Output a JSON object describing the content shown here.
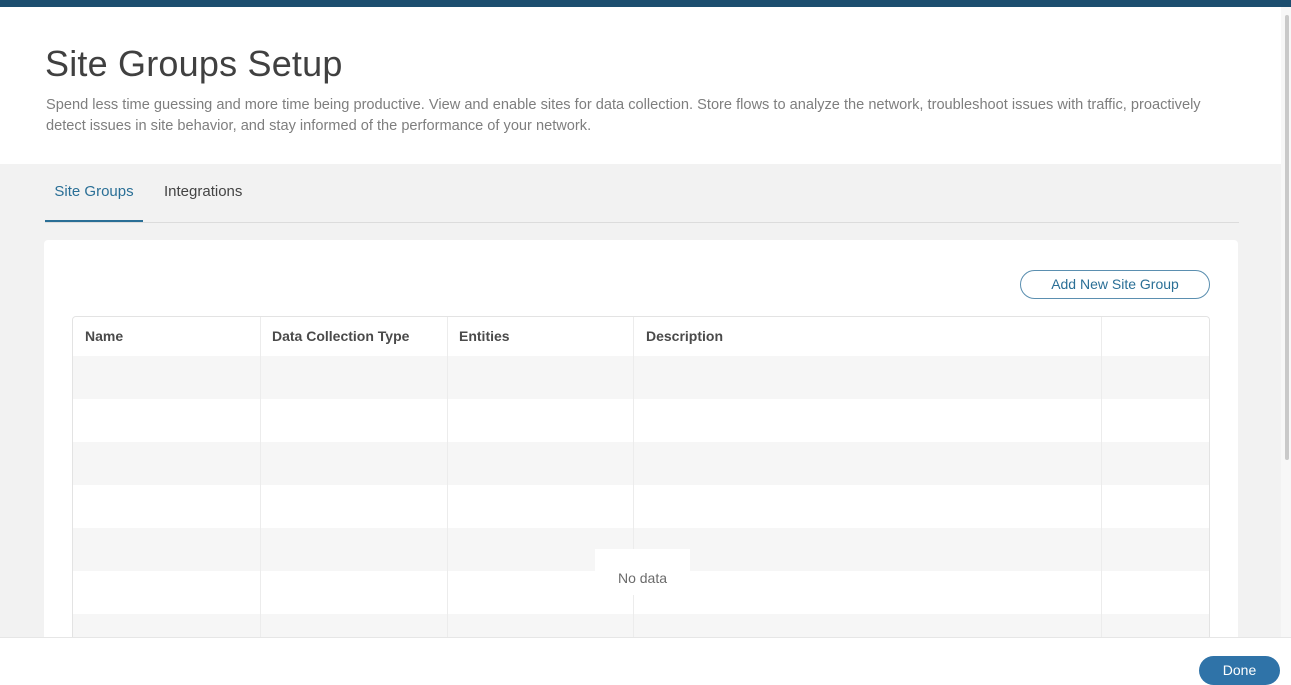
{
  "header": {
    "title": "Site Groups Setup",
    "description": "Spend less time guessing and more time being productive. View and enable sites for data collection. Store flows to analyze the network, troubleshoot issues with traffic, proactively detect issues in site behavior, and stay informed of the performance of your network."
  },
  "tabs": [
    {
      "label": "Site Groups",
      "active": true
    },
    {
      "label": "Integrations",
      "active": false
    }
  ],
  "toolbar": {
    "add_label": "Add New Site Group"
  },
  "table": {
    "columns": [
      "Name",
      "Data Collection Type",
      "Entities",
      "Description",
      ""
    ],
    "empty_text": "No data"
  },
  "footer": {
    "done_label": "Done"
  },
  "colors": {
    "top_bar": "#1d4e6f",
    "accent": "#2a6f96",
    "primary_button": "#2f73a8"
  }
}
